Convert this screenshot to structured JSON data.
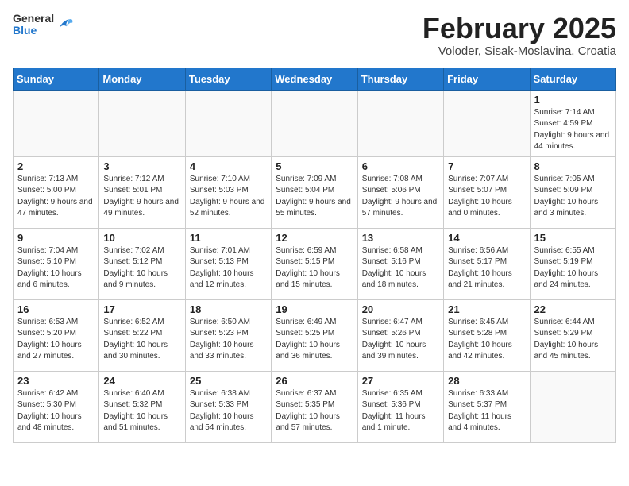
{
  "header": {
    "logo_general": "General",
    "logo_blue": "Blue",
    "month_title": "February 2025",
    "location": "Voloder, Sisak-Moslavina, Croatia"
  },
  "weekdays": [
    "Sunday",
    "Monday",
    "Tuesday",
    "Wednesday",
    "Thursday",
    "Friday",
    "Saturday"
  ],
  "weeks": [
    [
      {
        "day": "",
        "info": ""
      },
      {
        "day": "",
        "info": ""
      },
      {
        "day": "",
        "info": ""
      },
      {
        "day": "",
        "info": ""
      },
      {
        "day": "",
        "info": ""
      },
      {
        "day": "",
        "info": ""
      },
      {
        "day": "1",
        "info": "Sunrise: 7:14 AM\nSunset: 4:59 PM\nDaylight: 9 hours and 44 minutes."
      }
    ],
    [
      {
        "day": "2",
        "info": "Sunrise: 7:13 AM\nSunset: 5:00 PM\nDaylight: 9 hours and 47 minutes."
      },
      {
        "day": "3",
        "info": "Sunrise: 7:12 AM\nSunset: 5:01 PM\nDaylight: 9 hours and 49 minutes."
      },
      {
        "day": "4",
        "info": "Sunrise: 7:10 AM\nSunset: 5:03 PM\nDaylight: 9 hours and 52 minutes."
      },
      {
        "day": "5",
        "info": "Sunrise: 7:09 AM\nSunset: 5:04 PM\nDaylight: 9 hours and 55 minutes."
      },
      {
        "day": "6",
        "info": "Sunrise: 7:08 AM\nSunset: 5:06 PM\nDaylight: 9 hours and 57 minutes."
      },
      {
        "day": "7",
        "info": "Sunrise: 7:07 AM\nSunset: 5:07 PM\nDaylight: 10 hours and 0 minutes."
      },
      {
        "day": "8",
        "info": "Sunrise: 7:05 AM\nSunset: 5:09 PM\nDaylight: 10 hours and 3 minutes."
      }
    ],
    [
      {
        "day": "9",
        "info": "Sunrise: 7:04 AM\nSunset: 5:10 PM\nDaylight: 10 hours and 6 minutes."
      },
      {
        "day": "10",
        "info": "Sunrise: 7:02 AM\nSunset: 5:12 PM\nDaylight: 10 hours and 9 minutes."
      },
      {
        "day": "11",
        "info": "Sunrise: 7:01 AM\nSunset: 5:13 PM\nDaylight: 10 hours and 12 minutes."
      },
      {
        "day": "12",
        "info": "Sunrise: 6:59 AM\nSunset: 5:15 PM\nDaylight: 10 hours and 15 minutes."
      },
      {
        "day": "13",
        "info": "Sunrise: 6:58 AM\nSunset: 5:16 PM\nDaylight: 10 hours and 18 minutes."
      },
      {
        "day": "14",
        "info": "Sunrise: 6:56 AM\nSunset: 5:17 PM\nDaylight: 10 hours and 21 minutes."
      },
      {
        "day": "15",
        "info": "Sunrise: 6:55 AM\nSunset: 5:19 PM\nDaylight: 10 hours and 24 minutes."
      }
    ],
    [
      {
        "day": "16",
        "info": "Sunrise: 6:53 AM\nSunset: 5:20 PM\nDaylight: 10 hours and 27 minutes."
      },
      {
        "day": "17",
        "info": "Sunrise: 6:52 AM\nSunset: 5:22 PM\nDaylight: 10 hours and 30 minutes."
      },
      {
        "day": "18",
        "info": "Sunrise: 6:50 AM\nSunset: 5:23 PM\nDaylight: 10 hours and 33 minutes."
      },
      {
        "day": "19",
        "info": "Sunrise: 6:49 AM\nSunset: 5:25 PM\nDaylight: 10 hours and 36 minutes."
      },
      {
        "day": "20",
        "info": "Sunrise: 6:47 AM\nSunset: 5:26 PM\nDaylight: 10 hours and 39 minutes."
      },
      {
        "day": "21",
        "info": "Sunrise: 6:45 AM\nSunset: 5:28 PM\nDaylight: 10 hours and 42 minutes."
      },
      {
        "day": "22",
        "info": "Sunrise: 6:44 AM\nSunset: 5:29 PM\nDaylight: 10 hours and 45 minutes."
      }
    ],
    [
      {
        "day": "23",
        "info": "Sunrise: 6:42 AM\nSunset: 5:30 PM\nDaylight: 10 hours and 48 minutes."
      },
      {
        "day": "24",
        "info": "Sunrise: 6:40 AM\nSunset: 5:32 PM\nDaylight: 10 hours and 51 minutes."
      },
      {
        "day": "25",
        "info": "Sunrise: 6:38 AM\nSunset: 5:33 PM\nDaylight: 10 hours and 54 minutes."
      },
      {
        "day": "26",
        "info": "Sunrise: 6:37 AM\nSunset: 5:35 PM\nDaylight: 10 hours and 57 minutes."
      },
      {
        "day": "27",
        "info": "Sunrise: 6:35 AM\nSunset: 5:36 PM\nDaylight: 11 hours and 1 minute."
      },
      {
        "day": "28",
        "info": "Sunrise: 6:33 AM\nSunset: 5:37 PM\nDaylight: 11 hours and 4 minutes."
      },
      {
        "day": "",
        "info": ""
      }
    ]
  ]
}
